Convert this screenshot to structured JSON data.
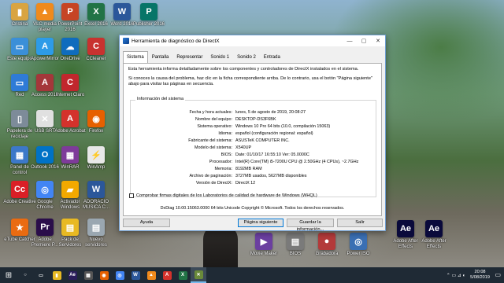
{
  "desktop": {
    "icons": [
      {
        "label": "Cristina",
        "color": "#d9a441",
        "glyph": "▮"
      },
      {
        "label": "VLC media player",
        "color": "#f08a1c",
        "glyph": "▲"
      },
      {
        "label": "PowerPoint 2016",
        "color": "#c64424",
        "glyph": "P"
      },
      {
        "label": "Excel 2016",
        "color": "#217346",
        "glyph": "X"
      },
      {
        "label": "Word 2016",
        "color": "#2b579a",
        "glyph": "W"
      },
      {
        "label": "Publisher 2016",
        "color": "#077568",
        "glyph": "P"
      },
      {
        "label": "Este equipo",
        "color": "#3b8fd8",
        "glyph": "▭"
      },
      {
        "label": "ApowerMirror",
        "color": "#2d9be8",
        "glyph": "A"
      },
      {
        "label": "OneDrive",
        "color": "#0f6cbd",
        "glyph": "☁"
      },
      {
        "label": "CCleaner",
        "color": "#c8322f",
        "glyph": "C"
      },
      {
        "label": "Red",
        "color": "#2f7bd6",
        "glyph": "▭"
      },
      {
        "label": "Access 2016",
        "color": "#a4373a",
        "glyph": "A"
      },
      {
        "label": "Internet Claro",
        "color": "#c1272d",
        "glyph": "C"
      },
      {
        "label": "Papelera de reciclaje",
        "color": "#7d8b99",
        "glyph": "▯"
      },
      {
        "label": "USB SRT",
        "color": "#e0e0e0",
        "glyph": "✕"
      },
      {
        "label": "Adobe Acrobat",
        "color": "#d4322c",
        "glyph": "A"
      },
      {
        "label": "Firefox",
        "color": "#e66000",
        "glyph": "◉"
      },
      {
        "label": "Panel de control",
        "color": "#3c78c9",
        "glyph": "▦"
      },
      {
        "label": "Outlook 2016",
        "color": "#0072c6",
        "glyph": "O"
      },
      {
        "label": "WinRAR",
        "color": "#7e3b9a",
        "glyph": "▦"
      },
      {
        "label": "WinAmp",
        "color": "#e8e8e8",
        "glyph": "⚡"
      },
      {
        "label": "Adobe Creative",
        "color": "#da1f26",
        "glyph": "Cc"
      },
      {
        "label": "Google Chrome",
        "color": "#4285f4",
        "glyph": "◎"
      },
      {
        "label": "Activador Windows",
        "color": "#f2a900",
        "glyph": "▰"
      },
      {
        "label": "ADORACIO MUSICA C...",
        "color": "#2b579a",
        "glyph": "W"
      },
      {
        "label": "eTube Catcher",
        "color": "#ea6b11",
        "glyph": "★"
      },
      {
        "label": "Adobe Premiere P...",
        "color": "#2a0d4a",
        "glyph": "Pr"
      },
      {
        "label": "Pack de Servidores",
        "color": "#e8b923",
        "glyph": "▤"
      },
      {
        "label": "Nuevo servidores",
        "color": "#9aa7b1",
        "glyph": "▤"
      }
    ],
    "right_icons": [
      {
        "label": "Adobe After Effects",
        "color": "#0a0a3b",
        "glyph": "Ae"
      },
      {
        "label": "Adobe After Effects",
        "color": "#0a0a3b",
        "glyph": "Ae"
      }
    ],
    "mid_icons": [
      {
        "label": "Movie Maker",
        "color": "#6b3fa0",
        "glyph": "▶"
      },
      {
        "label": "BIOS",
        "color": "#7a7a7a",
        "glyph": "▤"
      },
      {
        "label": "Grabadora",
        "color": "#b33a3a",
        "glyph": "●"
      },
      {
        "label": "Power ISO",
        "color": "#3a6fb3",
        "glyph": "◎"
      }
    ]
  },
  "dialog": {
    "title": "Herramienta de diagnóstico de DirectX",
    "tabs": [
      "Sistema",
      "Pantalla",
      "Representar",
      "Sonido 1",
      "Sonido 2",
      "Entrada"
    ],
    "intro": "Esta herramienta informa detalladamente sobre los componentes y controladores de DirectX instalados en el sistema.",
    "help": "Si conoces la causa del problema, haz clic en la ficha correspondiente arriba. De lo contrario, usa el botón \"Página siguiente\" abajo para visitar las páginas en secuencia.",
    "group_title": "Información del sistema",
    "rows": [
      {
        "k": "Fecha y hora actuales:",
        "v": "lunes, 5 de agosto de 2019, 20:08:27"
      },
      {
        "k": "Nombre del equipo:",
        "v": "DESKTOP-DS3F6BK"
      },
      {
        "k": "Sistema operativo:",
        "v": "Windows 10 Pro 64 bits (10.0, compilación 15063)"
      },
      {
        "k": "Idioma:",
        "v": "español (configuración regional: español)"
      },
      {
        "k": "Fabricante del sistema:",
        "v": "ASUSTeK COMPUTER INC."
      },
      {
        "k": "Modelo del sistema:",
        "v": "X540UP"
      },
      {
        "k": "BIOS:",
        "v": "Date: 01/10/17 16:55:10 Ver: 05.0000C"
      },
      {
        "k": "Procesador:",
        "v": "Intel(R) Core(TM) i5-7200U CPU @ 2.50GHz (4 CPUs), ~2.7GHz"
      },
      {
        "k": "Memoria:",
        "v": "8192MB RAM"
      },
      {
        "k": "Archivo de paginación:",
        "v": "3727MB usados, 5627MB disponibles"
      },
      {
        "k": "Versión de DirectX:",
        "v": "DirectX 12"
      }
    ],
    "checkbox": "Comprobar firmas digitales de los Laboratorios de calidad de hardware de Windows (WHQL)",
    "footer": "DxDiag 10.00.15063.0000 64 bits Unicode  Copyright © Microsoft. Todos los derechos reservados.",
    "buttons": {
      "help": "Ayuda",
      "next": "Página siguiente",
      "save": "Guardar la información...",
      "exit": "Salir"
    }
  },
  "taskbar": {
    "start": "⊞",
    "items": [
      {
        "name": "search",
        "color": "#1f2a35",
        "glyph": "○"
      },
      {
        "name": "task-view",
        "color": "#1f2a35",
        "glyph": "▭"
      },
      {
        "name": "file-explorer",
        "color": "#e8b923",
        "glyph": "▮"
      },
      {
        "name": "after-effects",
        "color": "#2a1d5a",
        "glyph": "Ae"
      },
      {
        "name": "film",
        "color": "#555",
        "glyph": "▦"
      },
      {
        "name": "firefox",
        "color": "#e66000",
        "glyph": "◉"
      },
      {
        "name": "chrome",
        "color": "#4285f4",
        "glyph": "◎"
      },
      {
        "name": "word",
        "color": "#2b579a",
        "glyph": "W"
      },
      {
        "name": "vlc",
        "color": "#f08a1c",
        "glyph": "▲"
      },
      {
        "name": "adobe",
        "color": "#d4322c",
        "glyph": "A"
      },
      {
        "name": "excel",
        "color": "#217346",
        "glyph": "X"
      },
      {
        "name": "directx",
        "color": "#6a8a3a",
        "glyph": "✕"
      }
    ],
    "tray": "⌃  ▭  ⊿  ◐",
    "time": "20:08",
    "date": "5/08/2019",
    "notifications": "▭"
  }
}
